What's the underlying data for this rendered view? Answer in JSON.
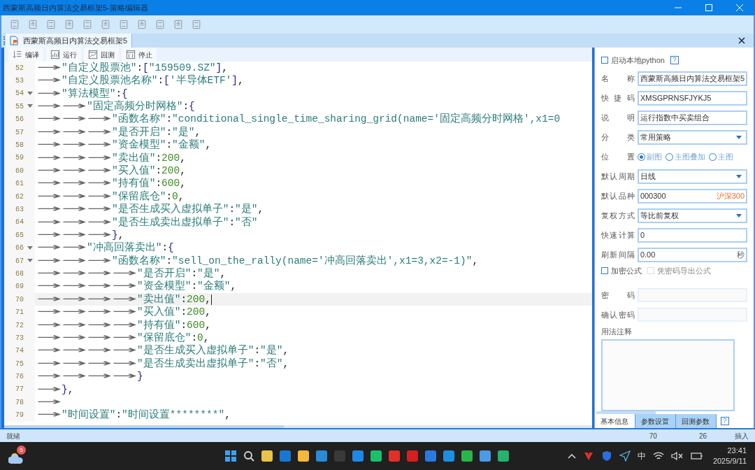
{
  "window": {
    "title": "西蒙斯高频日内算法交易框架5-策略编辑器"
  },
  "document_tab": {
    "label": "西蒙斯高频日内算法交易框架5",
    "selected": true
  },
  "editor_toolbar": [
    {
      "kind": "compile",
      "label": "编译"
    },
    {
      "kind": "run",
      "label": "运行"
    },
    {
      "kind": "backtest",
      "label": "回测"
    },
    {
      "kind": "stop",
      "label": "停止"
    }
  ],
  "code_lines": [
    {
      "number": "52",
      "text": "→\"自定义股票池\":[\"159509.SZ\"],",
      "foldable": false,
      "current": false
    },
    {
      "number": "53",
      "text": "→\"自定义股票池名称\":['半导体ETF'],",
      "foldable": false,
      "current": false
    },
    {
      "number": "54",
      "text": "→\"算法模型\":{",
      "foldable": true,
      "current": false
    },
    {
      "number": "55",
      "text": "→→\"固定高频分时网格\":{",
      "foldable": true,
      "current": false
    },
    {
      "number": "56",
      "text": "→→→\"函数名称\":\"conditional_single_time_sharing_grid(name='固定高频分时网格',x1=0",
      "foldable": false,
      "current": false
    },
    {
      "number": "57",
      "text": "→→→\"是否开启\":\"是\",",
      "foldable": false,
      "current": false
    },
    {
      "number": "58",
      "text": "→→→\"资金模型\":\"金额\",",
      "foldable": false,
      "current": false
    },
    {
      "number": "59",
      "text": "→→→\"卖出值\":200,",
      "foldable": false,
      "current": false
    },
    {
      "number": "60",
      "text": "→→→\"买入值\":200,",
      "foldable": false,
      "current": false
    },
    {
      "number": "61",
      "text": "→→→\"持有值\":600,",
      "foldable": false,
      "current": false
    },
    {
      "number": "62",
      "text": "→→→\"保留底仓\":0,",
      "foldable": false,
      "current": false
    },
    {
      "number": "63",
      "text": "→→→\"是否生成买入虚拟单子\":\"是\",",
      "foldable": false,
      "current": false
    },
    {
      "number": "64",
      "text": "→→→\"是否生成卖出虚拟单子\":\"否\"",
      "foldable": false,
      "current": false
    },
    {
      "number": "65",
      "text": "→→→},",
      "foldable": false,
      "current": false
    },
    {
      "number": "66",
      "text": "→→\"冲高回落卖出\":{",
      "foldable": true,
      "current": false
    },
    {
      "number": "67",
      "text": "→→→\"函数名称\":\"sell_on_the_rally(name='冲高回落卖出',x1=3,x2=-1)\",",
      "foldable": true,
      "current": false
    },
    {
      "number": "68",
      "text": "→→→→\"是否开启\":\"是\",",
      "foldable": false,
      "current": false
    },
    {
      "number": "69",
      "text": "→→→→\"资金模型\":\"金额\",",
      "foldable": false,
      "current": false
    },
    {
      "number": "70",
      "text": "→→→→\"卖出值\":200,",
      "foldable": false,
      "current": true
    },
    {
      "number": "71",
      "text": "→→→→\"买入值\":200,",
      "foldable": false,
      "current": false
    },
    {
      "number": "72",
      "text": "→→→→\"持有值\":600,",
      "foldable": false,
      "current": false
    },
    {
      "number": "73",
      "text": "→→→→\"保留底仓\":0,",
      "foldable": false,
      "current": false
    },
    {
      "number": "74",
      "text": "→→→→\"是否生成买入虚拟单子\":\"是\",",
      "foldable": false,
      "current": false
    },
    {
      "number": "75",
      "text": "→→→→\"是否生成卖出虚拟单子\":\"否\",",
      "foldable": false,
      "current": false
    },
    {
      "number": "76",
      "text": "→→→→}",
      "foldable": false,
      "current": false
    },
    {
      "number": "77",
      "text": "→},",
      "foldable": false,
      "current": false
    },
    {
      "number": "78",
      "text": "→",
      "foldable": false,
      "current": false
    },
    {
      "number": "79",
      "text": "→\"时间设置\":\"时间设置********\",",
      "foldable": false,
      "current": false
    }
  ],
  "properties": {
    "python_checkbox": {
      "label": "启动本地python",
      "checked": false
    },
    "help": "?",
    "fields": [
      {
        "kind": "text",
        "label": "名称",
        "value": "西蒙斯高频日内算法交易框架5"
      },
      {
        "kind": "text",
        "label": "快捷码",
        "value": "XMSGPRNSFJYKJ5"
      },
      {
        "kind": "text",
        "label": "说明",
        "value": "运行指数中买卖组合"
      },
      {
        "kind": "select",
        "label": "分类",
        "value": "常用策略"
      },
      {
        "kind": "radio",
        "label": "位置",
        "options": [
          {
            "label": "副图",
            "selected": true
          },
          {
            "label": "主图叠加",
            "selected": false
          },
          {
            "label": "主图",
            "selected": false
          }
        ]
      },
      {
        "kind": "select",
        "label": "默认周期",
        "value": "日线"
      },
      {
        "kind": "text",
        "label": "默认品种",
        "value": "000300",
        "suffix": "沪深300",
        "color": "#f07030"
      },
      {
        "kind": "select",
        "label": "复权方式",
        "value": "等比前复权"
      },
      {
        "kind": "text",
        "label": "快速计算",
        "value": "0"
      },
      {
        "kind": "text",
        "label": "刷新间隔",
        "value": "0.00",
        "suffix": "秒"
      }
    ],
    "options": [
      {
        "label": "加密公式",
        "checked": false,
        "disabled": false
      },
      {
        "label": "凭密码导出公式",
        "checked": false,
        "disabled": true
      }
    ],
    "password_fields": [
      {
        "label": "密码",
        "disabled": true
      },
      {
        "label": "确认密码",
        "disabled": true
      }
    ],
    "notes_label": "用法注释",
    "tabs": [
      {
        "label": "基本信息",
        "selected": true
      },
      {
        "label": "参数设置",
        "selected": false
      },
      {
        "label": "回测参数",
        "selected": false
      }
    ],
    "tabs_help": "?"
  },
  "status_bar": {
    "status": "就绪",
    "line": "70",
    "column": "26",
    "mode": "插入"
  },
  "taskbar": {
    "weather_badge": "5",
    "time": "23:41",
    "date": "2025/9/11",
    "ime": "中"
  }
}
